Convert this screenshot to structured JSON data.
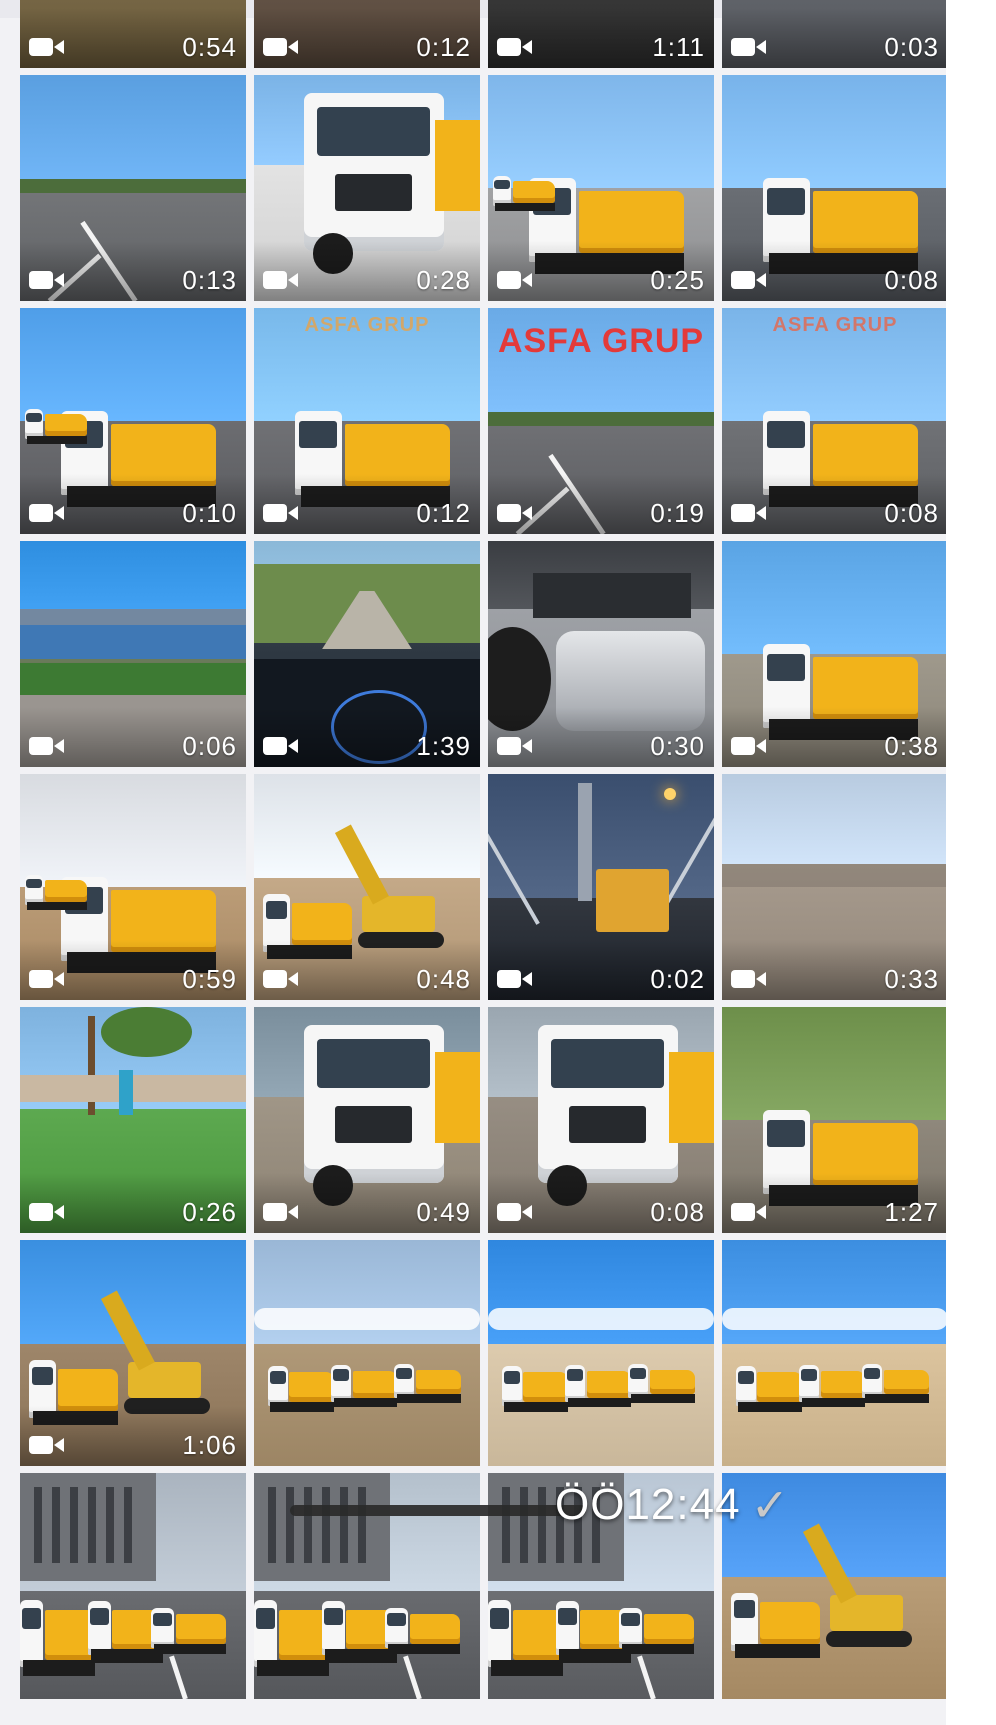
{
  "gallery": {
    "tiles": [
      {
        "duration": "0:54",
        "sky": "#3b4a44",
        "ground": "#6b5b3a",
        "scene": "ground"
      },
      {
        "duration": "0:12",
        "sky": "#6c5a40",
        "ground": "#57473a",
        "scene": "ground"
      },
      {
        "duration": "1:11",
        "sky": "#9aa0a7",
        "ground": "#2c2c2c",
        "scene": "ground"
      },
      {
        "duration": "0:03",
        "sky": "#6d7078",
        "ground": "#55585e",
        "scene": "ground"
      },
      {
        "duration": "0:13",
        "sky": "#5a9fe0",
        "ground": "#5f6164",
        "scene": "road"
      },
      {
        "duration": "0:28",
        "sky": "#7bb3e6",
        "ground": "#cfcfcf",
        "scene": "truck-close"
      },
      {
        "duration": "0:25",
        "sky": "#7fb6ea",
        "ground": "#8d8e90",
        "scene": "truck"
      },
      {
        "duration": "0:08",
        "sky": "#78b3ea",
        "ground": "#565a60",
        "scene": "truck"
      },
      {
        "duration": "0:10",
        "sky": "#4f9ee8",
        "ground": "#58595d",
        "scene": "truck"
      },
      {
        "duration": "0:12",
        "sky": "#78b8ea",
        "ground": "#5c5d61",
        "scene": "truck",
        "overlay": "ASFA GRUP",
        "overlay_color": "#e8a34a"
      },
      {
        "duration": "0:19",
        "sky": "#6aaae6",
        "ground": "#5b5c60",
        "scene": "road",
        "overlay": "ASFA GRUP",
        "overlay_color": "#e33a3a"
      },
      {
        "duration": "0:08",
        "sky": "#7ab4e8",
        "ground": "#5c5e62",
        "scene": "truck",
        "overlay": "ASFA GRUP",
        "overlay_color": "#e8674a"
      },
      {
        "duration": "0:06",
        "sky": "#2e8ee0",
        "ground": "#5a6a4a",
        "scene": "sea"
      },
      {
        "duration": "1:39",
        "sky": "#8bb8d8",
        "ground": "#1c2630",
        "scene": "dash"
      },
      {
        "duration": "0:30",
        "sky": "#3a3d42",
        "ground": "#8a8d92",
        "scene": "tank"
      },
      {
        "duration": "0:38",
        "sky": "#5aa4e4",
        "ground": "#8b8578",
        "scene": "truck"
      },
      {
        "duration": "0:59",
        "sky": "#d8dbe0",
        "ground": "#a78863",
        "scene": "truck"
      },
      {
        "duration": "0:48",
        "sky": "#dde2e8",
        "ground": "#b09574",
        "scene": "excavator"
      },
      {
        "duration": "0:02",
        "sky": "#3a4e6e",
        "ground": "#1e232b",
        "scene": "bridge"
      },
      {
        "duration": "0:33",
        "sky": "#b8cbe0",
        "ground": "#93877a",
        "scene": "ground"
      },
      {
        "duration": "0:26",
        "sky": "#7eb2de",
        "ground": "#49953c",
        "scene": "park"
      },
      {
        "duration": "0:49",
        "sky": "#7a8e9c",
        "ground": "#8c8273",
        "scene": "truck-close"
      },
      {
        "duration": "0:08",
        "sky": "#9aa6b0",
        "ground": "#837a6f",
        "scene": "truck-close"
      },
      {
        "duration": "1:27",
        "sky": "#6d8f4a",
        "ground": "#7b7468",
        "scene": "truck"
      },
      {
        "duration": "1:06",
        "sky": "#3a8fe0",
        "ground": "#8a7256",
        "scene": "excavator"
      },
      {
        "duration": "",
        "sky": "#9ab7d6",
        "ground": "#9c8564",
        "scene": "convoy"
      },
      {
        "duration": "",
        "sky": "#2f87df",
        "ground": "#c9b79a",
        "scene": "convoy"
      },
      {
        "duration": "",
        "sky": "#3c8ee0",
        "ground": "#c8b08a",
        "scene": "convoy"
      },
      {
        "duration": "",
        "sky": "#aab4bf",
        "ground": "#56585c",
        "scene": "street"
      },
      {
        "duration": "",
        "sky": "#b4c0cc",
        "ground": "#55575b",
        "scene": "street"
      },
      {
        "duration": "",
        "sky": "#b9c6d4",
        "ground": "#595b5f",
        "scene": "street"
      },
      {
        "duration": "",
        "sky": "#3e8ae0",
        "ground": "#a58963",
        "scene": "excavator"
      }
    ]
  },
  "footer": {
    "time": "ÖÖ12:44",
    "check_icon": "check-icon"
  }
}
